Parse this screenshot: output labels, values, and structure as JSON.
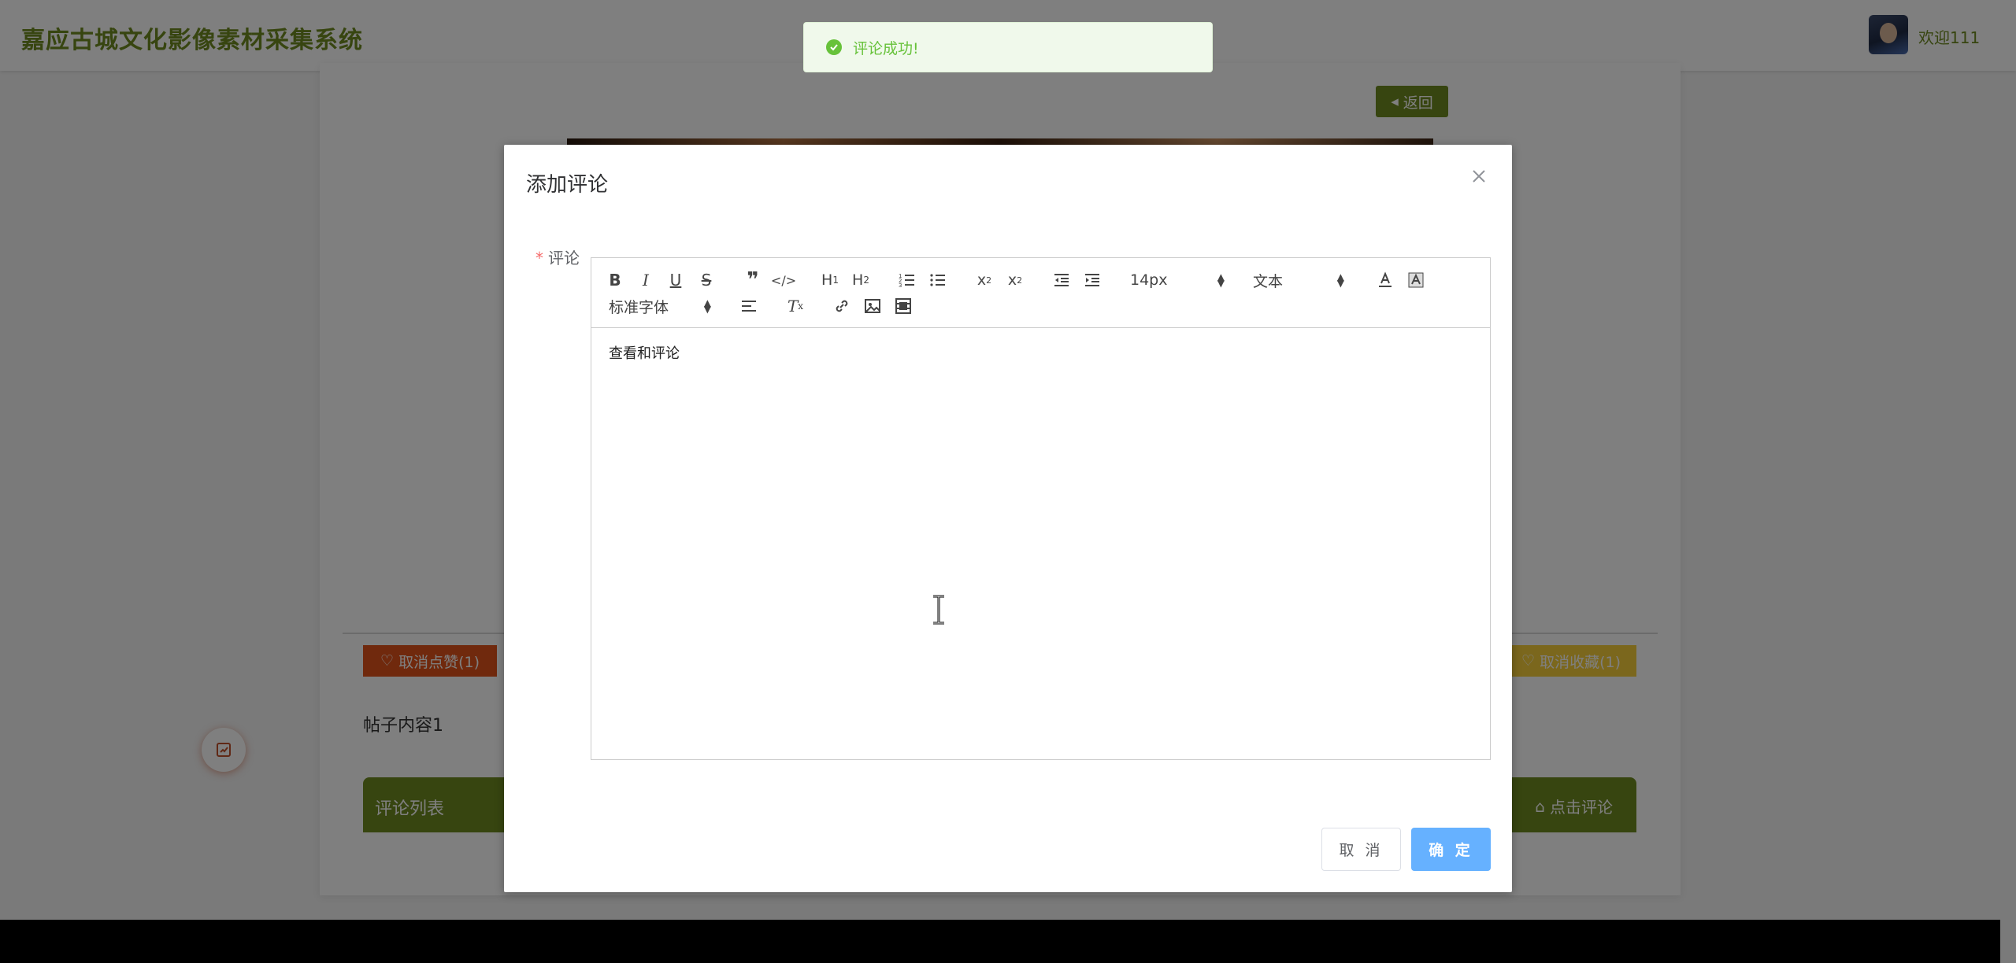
{
  "header": {
    "site_title": "嘉应古城文化影像素材采集系统",
    "welcome": "欢迎111"
  },
  "page": {
    "back_label": "返回",
    "like_label": "取消点赞(1)",
    "favorite_label": "取消收藏(1)",
    "post_content": "帖子内容1",
    "comment_list_title": "评论列表",
    "comment_button_label": "点击评论"
  },
  "toast": {
    "message": "评论成功!"
  },
  "dialog": {
    "title": "添加评论",
    "field_label": "评论",
    "editor": {
      "font_size": "14px",
      "header_style": "文本",
      "font_family": "标准字体",
      "content": "查看和评论"
    },
    "cancel_label": "取 消",
    "confirm_label": "确 定"
  },
  "colors": {
    "brand": "#6f8a20",
    "primary": "#66b1ff",
    "success": "#67c23a",
    "like": "#e0521b",
    "favorite": "#f6cf3b"
  }
}
